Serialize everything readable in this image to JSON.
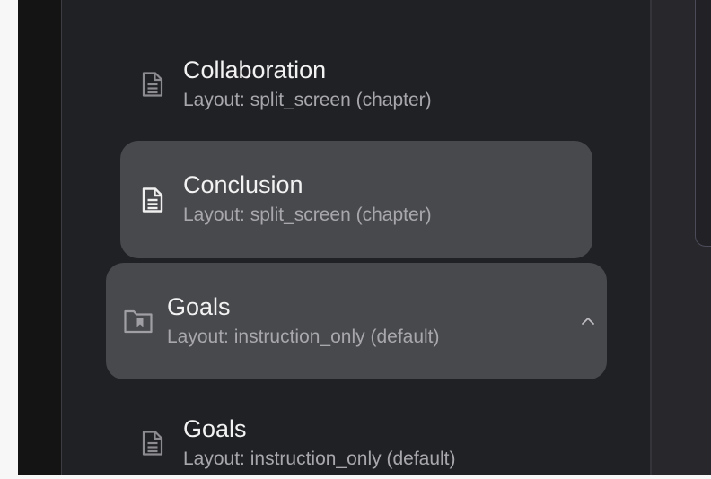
{
  "colors": {
    "panel_bg": "#202125",
    "highlight_bg": "#48494d",
    "title_text": "#f2f2f2",
    "subtitle_text": "#a8a8ac"
  },
  "items": [
    {
      "title": "Collaboration",
      "subtitle": "Layout: split_screen (chapter)",
      "icon": "document-icon"
    },
    {
      "title": "Conclusion",
      "subtitle": "Layout: split_screen (chapter)",
      "icon": "document-icon"
    },
    {
      "title": "Goals",
      "subtitle": "Layout: instruction_only (default)",
      "icon": "folder-bookmark-icon",
      "expanded": true
    },
    {
      "title": "Goals",
      "subtitle": "Layout: instruction_only (default)",
      "icon": "document-icon"
    }
  ]
}
